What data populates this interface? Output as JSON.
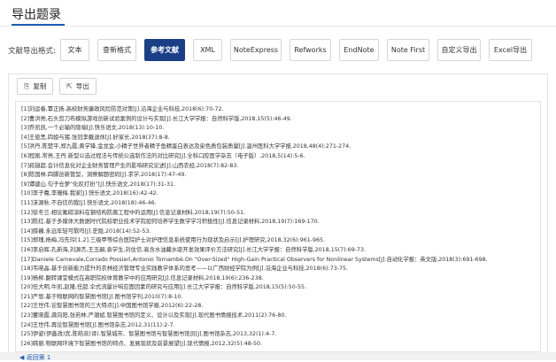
{
  "page": {
    "title": "导出题录"
  },
  "formats": {
    "label": "文献导出格式:",
    "items": [
      {
        "label": "文本",
        "active": false
      },
      {
        "label": "查新格式",
        "active": false
      },
      {
        "label": "参考文献",
        "active": true
      },
      {
        "label": "XML",
        "active": false
      },
      {
        "label": "NoteExpress",
        "active": false
      },
      {
        "label": "Refworks",
        "active": false
      },
      {
        "label": "EndNote",
        "active": false
      },
      {
        "label": "Note First",
        "active": false
      },
      {
        "label": "自定义导出",
        "active": false
      },
      {
        "label": "Excel导出",
        "active": false
      }
    ]
  },
  "actions": {
    "copy_label": "复制",
    "export_label": "导出",
    "copy_icon": "copy-icon",
    "export_icon": "export-icon"
  },
  "references": [
    "[1]刘运春,覃正扬.高校财务廉政风险防范对策[J].沿海企业与科技,2018(6):70-72.",
    "[2]曹洪亮,石头剪刀布模拟游戏创新试验案例的设计与实现[J].长江大学学报：自然科学版,2018,15(5):46-49.",
    "[3]乔凯凯,一个必输的隐喻[J].快乐语文,2018(13):10-10.",
    "[4]王俊黑,四娘与猪.张冠李戴退休[J].好家长,2018(37):8-8.",
    "[5]洪丹,陈楚平,郑九霞,黄学锋,金龙金,小精子世界者精子鱼精蛋白表达及染色质包装质量[J].温州医科大学学报,2018,48(4):271-274.",
    "[6]程刚,常亮,王丹.新型公选过程法与传统公选制作法的对比研究[J].全科口腔医学杂志（电子版）,2018,5(14):5-6.",
    "[7]叔翅超.会计信息化对企业财务管理产生的影响研究论述[J].山西农经,2018(7):82-83.",
    "[8]陈国林.四脚创新管型，洞察解题密码[J].求学,2018(17):47-49.",
    "[9]谭建山.句子仓萝“化叹打扮”[J].快乐语文,2018(17):31-31.",
    "[10]李子羲,李珊梅.我家[J].快乐语文,2018(16):42-42.",
    "[11]沫源秋.不自信的我[J].快乐语文,2018(18):46-46.",
    "[12]徐冬兰.相论氟碳涂料在钢结构防腐工程中的运用[J].信息记录材料,2018,19(7):50-51.",
    "[13]陈红.基于多媒体大数据时代院校职业技术学院如何培养学生数学学习积极性[J].信息记录材料,2018,19(7):169-170.",
    "[14]薛巍.永远年轻可歌吗[J].史陇,2018(14):52-53.",
    "[15]郑瑰,杨梅,冯先玲[1,2].三级甲等综合医院护士对护理信息系统使用行为现状及启示[J].护理研究,2018,32(6):961-965.",
    "[16]李启辉,孔新海,刘源杰,王玉嗣,袁学生,刘住信.高含水油藏水驱开发效果评价方法研究[J].长江大学学报：自然科学版,2018,15(7):69-73.",
    "[17]Daniele Carnevale,Corrado Possieri,Antonio Tornambè.On \"Over-Sized\" High-Gain Practical Observers for Nonlinear Systems[J].自动化学报：英文版,2018(3):691-698.",
    "[18]韦晓晶.基于创新能力提升的农林经济管理专业实践教学体系的思考——以广西财经学院为例[J].沿海企业与科技,2018(6):73-75.",
    "[19]杨柳.翻转课堂模式在高职院校体育教学中的应用研究[J].信息记录材料,2018,19(6):236-238.",
    "[20]任大明,牛凯,赵隆,任超.伞式流量计响应面因素的研究与应用[J].长江大学学报：自然科学版,2018,15(5):50-55.",
    "[21]严悠.基于物联网的智慧图书馆[J].图书馆学刊,2010(7):8-10.",
    "[22]王世伟.论智慧图书馆的三大特点[J].中国图书馆学报,2012(6):22-28.",
    "[23]董晓霞,龚向阳,张若林,严潮斌.智慧图书馆的定义、设计以及实现[J].现代图书情报技术,2011(2):76-80.",
    "[24]王世伟.再论智慧图书馆[J].图书馆杂志,2012,31(11):2-7.",
    "[25]伊姿(伊鑫改)宾,陈皓欢(译).智慧城市、智慧图书馆与智慧图书馆员[J].图书馆杂志,2013,32(1):4-7.",
    "[26]韩丽.物联网环境下智慧图书馆的特点、发展现状及前景展望[J].现代情报,2012,32(5):48-50."
  ],
  "footer": {
    "text": "◀ 返回第 1"
  }
}
